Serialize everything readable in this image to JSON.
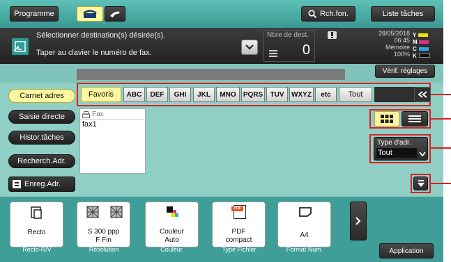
{
  "topbar": {
    "programme_label": "Programme",
    "search_label": "Rch.fon.",
    "job_list_label": "Liste tâches"
  },
  "infobar": {
    "line1": "Sélectionner destination(s) désirée(s).",
    "line2": "Taper au clavier le numéro de fax.",
    "dest_count_label": "Nbre de dest.",
    "dest_count": "0",
    "date": "28/05/2018",
    "time": "06:45",
    "memory_label": "Mémoire",
    "memory_value": "100%",
    "toner": [
      "Y",
      "M",
      "C",
      "K"
    ],
    "verify_settings_label": "Vérif. réglages"
  },
  "left_nav": [
    {
      "label": "Carnet adres"
    },
    {
      "label": "Saisie directe"
    },
    {
      "label": "Histor.tâches"
    },
    {
      "label": "Recherch.Adr."
    },
    {
      "label": "Enreg.Adr."
    }
  ],
  "tabs": [
    "Favoris",
    "ABC",
    "DEF",
    "GHI",
    "JKL",
    "MNO",
    "PQRS",
    "TUV",
    "WXYZ",
    "etc",
    "Tout"
  ],
  "list": {
    "type_label": "Fax",
    "entries": [
      "fax1"
    ]
  },
  "address_type": {
    "label": "Type d'adr.",
    "value": "Tout"
  },
  "tiles": [
    {
      "value": "Recto",
      "caption": "Recto-R/V"
    },
    {
      "value": "S 300 ppp\nF Fin",
      "caption": "Résolution"
    },
    {
      "value": "Couleur\nAuto",
      "caption": "Couleur"
    },
    {
      "value": "PDF\ncompact",
      "caption": "Type Fichier"
    },
    {
      "value": "A4",
      "caption": "Format Num."
    }
  ],
  "tile_lines": {
    "recto": "Recto",
    "res1": "S 300 ppp",
    "res2": "F Fin",
    "col1": "Couleur",
    "col2": "Auto",
    "pdf1": "PDF",
    "pdf2": "compact",
    "a4": "A4",
    "pdf_badge": "PDF"
  },
  "application_label": "Application",
  "colors": {
    "accent_yellow": "#fff6a0",
    "callout_red": "#e02020",
    "screen_teal": "#8fcfc6"
  }
}
